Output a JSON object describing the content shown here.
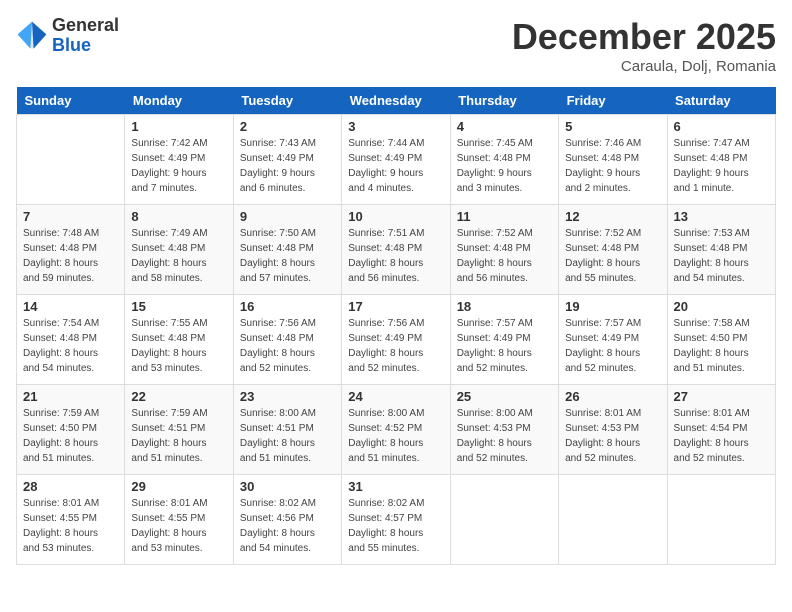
{
  "logo": {
    "general": "General",
    "blue": "Blue"
  },
  "title": "December 2025",
  "location": "Caraula, Dolj, Romania",
  "days_of_week": [
    "Sunday",
    "Monday",
    "Tuesday",
    "Wednesday",
    "Thursday",
    "Friday",
    "Saturday"
  ],
  "weeks": [
    [
      {
        "day": "",
        "sunrise": "",
        "sunset": "",
        "daylight": ""
      },
      {
        "day": "1",
        "sunrise": "Sunrise: 7:42 AM",
        "sunset": "Sunset: 4:49 PM",
        "daylight": "Daylight: 9 hours and 7 minutes."
      },
      {
        "day": "2",
        "sunrise": "Sunrise: 7:43 AM",
        "sunset": "Sunset: 4:49 PM",
        "daylight": "Daylight: 9 hours and 6 minutes."
      },
      {
        "day": "3",
        "sunrise": "Sunrise: 7:44 AM",
        "sunset": "Sunset: 4:49 PM",
        "daylight": "Daylight: 9 hours and 4 minutes."
      },
      {
        "day": "4",
        "sunrise": "Sunrise: 7:45 AM",
        "sunset": "Sunset: 4:48 PM",
        "daylight": "Daylight: 9 hours and 3 minutes."
      },
      {
        "day": "5",
        "sunrise": "Sunrise: 7:46 AM",
        "sunset": "Sunset: 4:48 PM",
        "daylight": "Daylight: 9 hours and 2 minutes."
      },
      {
        "day": "6",
        "sunrise": "Sunrise: 7:47 AM",
        "sunset": "Sunset: 4:48 PM",
        "daylight": "Daylight: 9 hours and 1 minute."
      }
    ],
    [
      {
        "day": "7",
        "sunrise": "Sunrise: 7:48 AM",
        "sunset": "Sunset: 4:48 PM",
        "daylight": "Daylight: 8 hours and 59 minutes."
      },
      {
        "day": "8",
        "sunrise": "Sunrise: 7:49 AM",
        "sunset": "Sunset: 4:48 PM",
        "daylight": "Daylight: 8 hours and 58 minutes."
      },
      {
        "day": "9",
        "sunrise": "Sunrise: 7:50 AM",
        "sunset": "Sunset: 4:48 PM",
        "daylight": "Daylight: 8 hours and 57 minutes."
      },
      {
        "day": "10",
        "sunrise": "Sunrise: 7:51 AM",
        "sunset": "Sunset: 4:48 PM",
        "daylight": "Daylight: 8 hours and 56 minutes."
      },
      {
        "day": "11",
        "sunrise": "Sunrise: 7:52 AM",
        "sunset": "Sunset: 4:48 PM",
        "daylight": "Daylight: 8 hours and 56 minutes."
      },
      {
        "day": "12",
        "sunrise": "Sunrise: 7:52 AM",
        "sunset": "Sunset: 4:48 PM",
        "daylight": "Daylight: 8 hours and 55 minutes."
      },
      {
        "day": "13",
        "sunrise": "Sunrise: 7:53 AM",
        "sunset": "Sunset: 4:48 PM",
        "daylight": "Daylight: 8 hours and 54 minutes."
      }
    ],
    [
      {
        "day": "14",
        "sunrise": "Sunrise: 7:54 AM",
        "sunset": "Sunset: 4:48 PM",
        "daylight": "Daylight: 8 hours and 54 minutes."
      },
      {
        "day": "15",
        "sunrise": "Sunrise: 7:55 AM",
        "sunset": "Sunset: 4:48 PM",
        "daylight": "Daylight: 8 hours and 53 minutes."
      },
      {
        "day": "16",
        "sunrise": "Sunrise: 7:56 AM",
        "sunset": "Sunset: 4:48 PM",
        "daylight": "Daylight: 8 hours and 52 minutes."
      },
      {
        "day": "17",
        "sunrise": "Sunrise: 7:56 AM",
        "sunset": "Sunset: 4:49 PM",
        "daylight": "Daylight: 8 hours and 52 minutes."
      },
      {
        "day": "18",
        "sunrise": "Sunrise: 7:57 AM",
        "sunset": "Sunset: 4:49 PM",
        "daylight": "Daylight: 8 hours and 52 minutes."
      },
      {
        "day": "19",
        "sunrise": "Sunrise: 7:57 AM",
        "sunset": "Sunset: 4:49 PM",
        "daylight": "Daylight: 8 hours and 52 minutes."
      },
      {
        "day": "20",
        "sunrise": "Sunrise: 7:58 AM",
        "sunset": "Sunset: 4:50 PM",
        "daylight": "Daylight: 8 hours and 51 minutes."
      }
    ],
    [
      {
        "day": "21",
        "sunrise": "Sunrise: 7:59 AM",
        "sunset": "Sunset: 4:50 PM",
        "daylight": "Daylight: 8 hours and 51 minutes."
      },
      {
        "day": "22",
        "sunrise": "Sunrise: 7:59 AM",
        "sunset": "Sunset: 4:51 PM",
        "daylight": "Daylight: 8 hours and 51 minutes."
      },
      {
        "day": "23",
        "sunrise": "Sunrise: 8:00 AM",
        "sunset": "Sunset: 4:51 PM",
        "daylight": "Daylight: 8 hours and 51 minutes."
      },
      {
        "day": "24",
        "sunrise": "Sunrise: 8:00 AM",
        "sunset": "Sunset: 4:52 PM",
        "daylight": "Daylight: 8 hours and 51 minutes."
      },
      {
        "day": "25",
        "sunrise": "Sunrise: 8:00 AM",
        "sunset": "Sunset: 4:53 PM",
        "daylight": "Daylight: 8 hours and 52 minutes."
      },
      {
        "day": "26",
        "sunrise": "Sunrise: 8:01 AM",
        "sunset": "Sunset: 4:53 PM",
        "daylight": "Daylight: 8 hours and 52 minutes."
      },
      {
        "day": "27",
        "sunrise": "Sunrise: 8:01 AM",
        "sunset": "Sunset: 4:54 PM",
        "daylight": "Daylight: 8 hours and 52 minutes."
      }
    ],
    [
      {
        "day": "28",
        "sunrise": "Sunrise: 8:01 AM",
        "sunset": "Sunset: 4:55 PM",
        "daylight": "Daylight: 8 hours and 53 minutes."
      },
      {
        "day": "29",
        "sunrise": "Sunrise: 8:01 AM",
        "sunset": "Sunset: 4:55 PM",
        "daylight": "Daylight: 8 hours and 53 minutes."
      },
      {
        "day": "30",
        "sunrise": "Sunrise: 8:02 AM",
        "sunset": "Sunset: 4:56 PM",
        "daylight": "Daylight: 8 hours and 54 minutes."
      },
      {
        "day": "31",
        "sunrise": "Sunrise: 8:02 AM",
        "sunset": "Sunset: 4:57 PM",
        "daylight": "Daylight: 8 hours and 55 minutes."
      },
      {
        "day": "",
        "sunrise": "",
        "sunset": "",
        "daylight": ""
      },
      {
        "day": "",
        "sunrise": "",
        "sunset": "",
        "daylight": ""
      },
      {
        "day": "",
        "sunrise": "",
        "sunset": "",
        "daylight": ""
      }
    ]
  ]
}
